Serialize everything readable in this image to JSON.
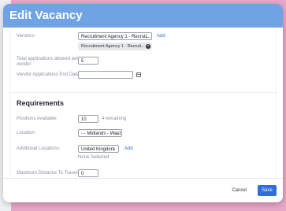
{
  "modal": {
    "title": "Edit Vacancy"
  },
  "vendors": {
    "label": "Vendors:",
    "selected": "Recruitment Agency 1 - Recruit...",
    "add_link": "Add",
    "chip": "Recruitment Agency 1 - Recruit..."
  },
  "total_apps": {
    "label": "Total applications allowed per vendor:",
    "value": "5"
  },
  "end_date": {
    "label": "Vendor Applications End Date:",
    "value": ""
  },
  "requirements": {
    "title": "Requirements"
  },
  "positions": {
    "label": "Positions Available:",
    "value": "10",
    "remaining": "4 remaining"
  },
  "location": {
    "label": "Location:",
    "selected": "- - Midlands - West"
  },
  "additional_locations": {
    "label": "Additional Locations:",
    "selected": "United Kingdom",
    "add_link": "Add",
    "none_selected": "None Selected"
  },
  "max_distance": {
    "label": "Maximum Distance To Travel:",
    "value": "0"
  },
  "footer": {
    "cancel": "Cancel",
    "save": "Save"
  },
  "colors": {
    "header": "#6fa3e4",
    "primary": "#2f6fd8",
    "backdrop": "#e8a6c8"
  },
  "icons": {
    "calendar": "calendar-icon",
    "chip_close": "close-icon",
    "dropdown": "chevron-down-icon"
  }
}
